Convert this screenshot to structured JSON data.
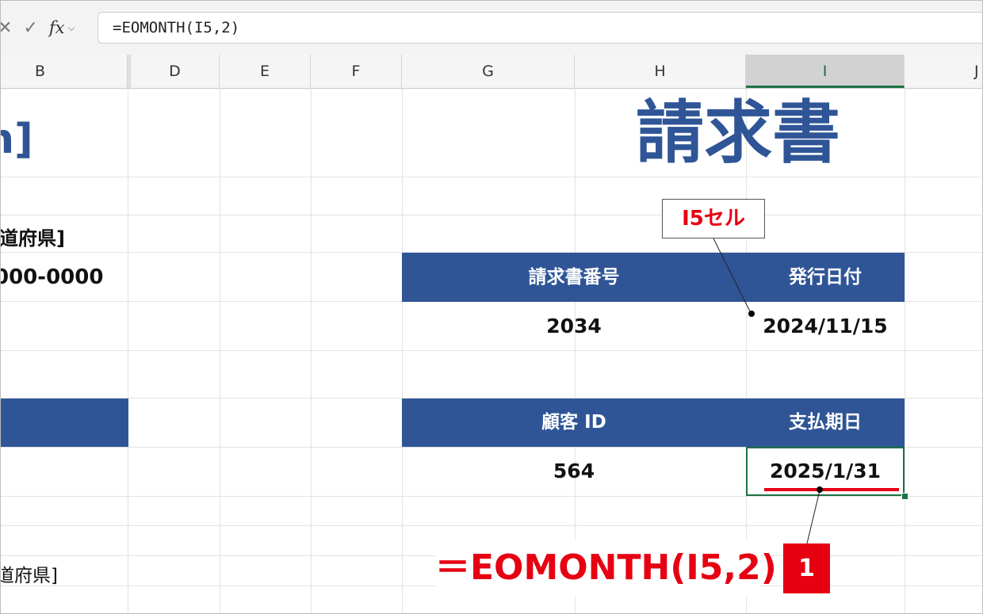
{
  "formula_bar": {
    "cancel_glyph": "✕",
    "enter_glyph": "✓",
    "fx_label": "fx",
    "dropdown_glyph": "⌵",
    "formula": "=EOMONTH(I5,2)"
  },
  "columns": [
    "B",
    "D",
    "E",
    "F",
    "G",
    "H",
    "I",
    "J"
  ],
  "selected_column": "I",
  "sheet": {
    "title": "請求書",
    "left_title_fragment": "h]",
    "left_prefecture_label": "道府県]",
    "left_phone": "000-0000",
    "left_bottom_text": "道府県]",
    "invoice_number_header": "請求書番号",
    "issue_date_header": "発行日付",
    "invoice_number": "2034",
    "issue_date": "2024/11/15",
    "customer_id_header": "顧客 ID",
    "due_date_header": "支払期日",
    "customer_id": "564",
    "due_date": "2025/1/31"
  },
  "annotations": {
    "cell_callout": "I5セル",
    "formula_text": "＝EOMONTH(I5,2)",
    "step_number": "1"
  },
  "colors": {
    "header_blue": "#2f5597",
    "title_blue": "#2f5597",
    "annotation_red": "#e60012",
    "excel_green": "#1e7145"
  }
}
